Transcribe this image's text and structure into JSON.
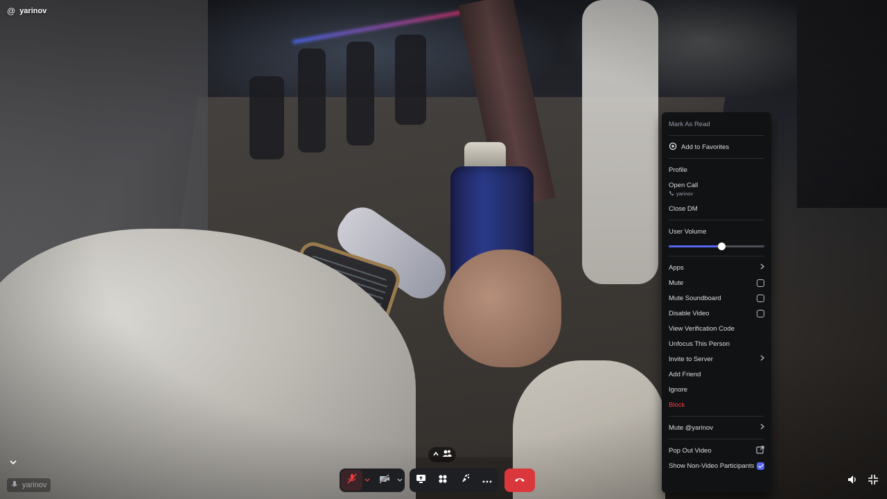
{
  "window": {
    "username_prefix": "@",
    "username": "yarinov"
  },
  "video_badge": {
    "name": "yarinov"
  },
  "controls": {
    "mic": "microphone-muted",
    "camera": "camera-off",
    "screen_share": "screen-share",
    "activities": "activities",
    "soundboard": "soundboard",
    "more": "more",
    "hang_up": "hang-up"
  },
  "menu": {
    "mark_as_read": "Mark As Read",
    "add_to_favorites": "Add to Favorites",
    "profile": "Profile",
    "open_call": "Open Call",
    "open_call_sub": "yarinov",
    "close_dm": "Close DM",
    "user_volume": "User Volume",
    "user_volume_value": 0.55,
    "apps": "Apps",
    "mute": "Mute",
    "mute_checked": false,
    "mute_soundboard": "Mute Soundboard",
    "mute_soundboard_checked": false,
    "disable_video": "Disable Video",
    "disable_video_checked": false,
    "view_verification_code": "View Verification Code",
    "unfocus_this_person": "Unfocus This Person",
    "invite_to_server": "Invite to Server",
    "add_friend": "Add Friend",
    "ignore": "Ignore",
    "block": "Block",
    "mute_user": "Mute @yarinov",
    "pop_out_video": "Pop Out Video",
    "show_non_video_participants": "Show Non-Video Participants",
    "show_non_video_checked": true
  },
  "colors": {
    "accent": "#5865f2",
    "danger": "#f23f42",
    "hangup": "#da373c",
    "menu_bg": "#111214"
  }
}
